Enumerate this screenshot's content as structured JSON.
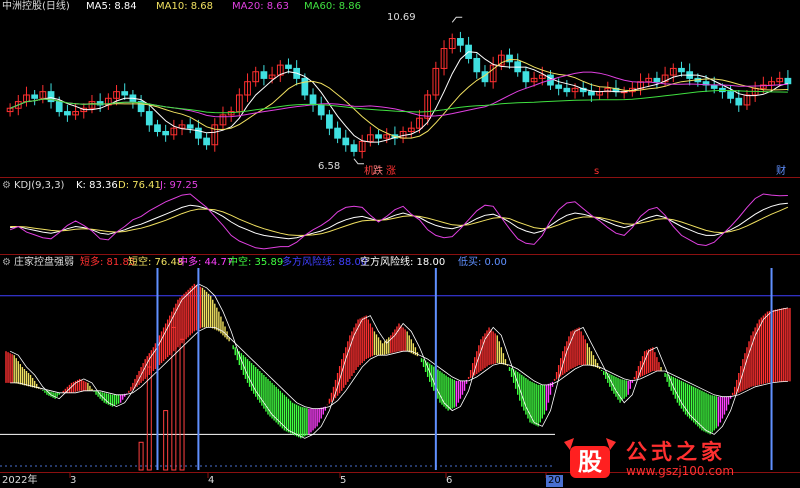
{
  "header_top": {
    "title": "中洲控股(日线)",
    "ma_labels": [
      {
        "text": "MA5: 8.84",
        "color": "#ffffff"
      },
      {
        "text": "MA10: 8.68",
        "color": "#f0e060"
      },
      {
        "text": "MA20: 8.63",
        "color": "#e040e0"
      },
      {
        "text": "MA60: 8.86",
        "color": "#40e040"
      }
    ]
  },
  "price_annotations": {
    "high": "10.69",
    "low": "6.58"
  },
  "event_markers": [
    {
      "text": "机",
      "color": "#ff4040"
    },
    {
      "text": "跌",
      "color": "#ff8080"
    },
    {
      "text": "涨",
      "color": "#ff3030"
    },
    {
      "text": "s",
      "color": "#ff3030"
    },
    {
      "text": "财",
      "color": "#6090ff"
    }
  ],
  "header_kdj": {
    "name": "KDJ(9,3,3)",
    "k": "K: 83.36",
    "d": "D: 76.41",
    "j": "J: 97.25",
    "colors": {
      "k": "#ffffff",
      "d": "#f0e060",
      "j": "#e040e0"
    }
  },
  "header_zj": {
    "name": "庄家控盘强弱",
    "items": [
      {
        "text": "短多: 81.85",
        "color": "#ff3030"
      },
      {
        "text": "短空: 76.48",
        "color": "#f0e060"
      },
      {
        "text": "中多: 44.77",
        "color": "#ff40ff"
      },
      {
        "text": "中空: 35.89",
        "color": "#40ff40"
      },
      {
        "text": "多方风险线: 88.00",
        "color": "#4040ff"
      },
      {
        "text": "空方风险线: 18.00",
        "color": "#ffffff"
      },
      {
        "text": "低买: 0.00",
        "color": "#6090ff"
      }
    ]
  },
  "x_axis": {
    "labels": [
      "2022年",
      "3",
      "4",
      "5",
      "6",
      "20"
    ]
  },
  "watermark": {
    "logo_text": "股",
    "text": "公式之家",
    "url": "www.gszj100.com"
  },
  "chart_data": [
    {
      "type": "candlestick",
      "title": "中洲控股(日线)",
      "close": [
        8.1,
        8.3,
        8.5,
        8.4,
        8.6,
        8.3,
        8.0,
        7.9,
        8.0,
        8.1,
        8.3,
        8.2,
        8.4,
        8.6,
        8.5,
        8.3,
        8.0,
        7.6,
        7.4,
        7.3,
        7.5,
        7.6,
        7.5,
        7.2,
        7.0,
        7.6,
        7.9,
        8.0,
        8.5,
        8.9,
        9.2,
        9.0,
        9.1,
        9.4,
        9.3,
        9.0,
        8.5,
        8.2,
        7.9,
        7.5,
        7.2,
        7.0,
        6.8,
        7.1,
        7.3,
        7.2,
        7.3,
        7.2,
        7.4,
        7.5,
        7.8,
        8.5,
        9.3,
        9.9,
        10.2,
        10.0,
        9.6,
        9.2,
        8.9,
        9.4,
        9.7,
        9.5,
        9.2,
        8.9,
        9.0,
        9.1,
        8.8,
        8.7,
        8.6,
        8.7,
        8.6,
        8.5,
        8.6,
        8.7,
        8.6,
        8.6,
        8.7,
        8.9,
        9.0,
        8.9,
        9.1,
        9.3,
        9.2,
        9.0,
        8.9,
        8.8,
        8.7,
        8.6,
        8.4,
        8.2,
        8.5,
        8.7,
        8.8,
        8.9,
        9.0,
        8.84
      ],
      "open": [
        8.0,
        8.1,
        8.3,
        8.5,
        8.4,
        8.6,
        8.3,
        8.0,
        7.9,
        8.0,
        8.1,
        8.3,
        8.2,
        8.4,
        8.6,
        8.5,
        8.3,
        8.0,
        7.6,
        7.4,
        7.3,
        7.5,
        7.6,
        7.5,
        7.2,
        7.0,
        7.6,
        7.9,
        8.0,
        8.5,
        8.9,
        9.2,
        9.0,
        9.1,
        9.4,
        9.3,
        9.0,
        8.5,
        8.2,
        7.9,
        7.5,
        7.2,
        7.0,
        6.8,
        7.1,
        7.3,
        7.2,
        7.3,
        7.2,
        7.4,
        7.5,
        7.8,
        8.5,
        9.3,
        9.9,
        10.2,
        10.0,
        9.6,
        9.2,
        8.9,
        9.4,
        9.7,
        9.5,
        9.2,
        8.9,
        9.0,
        9.1,
        8.8,
        8.7,
        8.6,
        8.7,
        8.6,
        8.5,
        8.6,
        8.7,
        8.6,
        8.6,
        8.7,
        8.9,
        9.0,
        8.9,
        9.1,
        9.3,
        9.2,
        9.0,
        8.9,
        8.8,
        8.7,
        8.6,
        8.4,
        8.2,
        8.5,
        8.7,
        8.8,
        8.9,
        9.0
      ],
      "annotations": {
        "high": 10.69,
        "low": 6.58
      },
      "series": [
        {
          "name": "MA5",
          "color": "#ffffff",
          "last": 8.84
        },
        {
          "name": "MA10",
          "color": "#f0e060",
          "last": 8.68
        },
        {
          "name": "MA20",
          "color": "#e040e0",
          "last": 8.63
        },
        {
          "name": "MA60",
          "color": "#40e040",
          "last": 8.86
        }
      ]
    },
    {
      "type": "line",
      "title": "KDJ(9,3,3)",
      "ylim": [
        0,
        100
      ],
      "series": [
        {
          "name": "K",
          "color": "#ffffff",
          "values": [
            40,
            42,
            38,
            35,
            32,
            30,
            33,
            38,
            42,
            40,
            36,
            30,
            28,
            32,
            36,
            42,
            46,
            52,
            58,
            64,
            70,
            76,
            80,
            78,
            74,
            68,
            60,
            50,
            42,
            36,
            30,
            26,
            24,
            22,
            20,
            22,
            26,
            30,
            34,
            40,
            48,
            54,
            58,
            60,
            56,
            52,
            56,
            62,
            66,
            62,
            58,
            50,
            44,
            40,
            38,
            42,
            48,
            56,
            62,
            64,
            58,
            50,
            40,
            34,
            30,
            34,
            44,
            54,
            62,
            66,
            64,
            60,
            56,
            50,
            44,
            40,
            44,
            52,
            58,
            62,
            58,
            50,
            42,
            36,
            30,
            26,
            26,
            30,
            36,
            44,
            54,
            64,
            72,
            78,
            82,
            83.36
          ]
        },
        {
          "name": "D",
          "color": "#f0e060",
          "values": [
            42,
            42,
            41,
            39,
            37,
            35,
            34,
            35,
            37,
            38,
            37,
            35,
            33,
            32,
            33,
            36,
            39,
            43,
            48,
            53,
            59,
            65,
            70,
            73,
            73,
            72,
            68,
            62,
            55,
            49,
            43,
            38,
            34,
            30,
            27,
            26,
            26,
            27,
            29,
            33,
            38,
            43,
            48,
            52,
            53,
            53,
            54,
            57,
            60,
            61,
            60,
            57,
            53,
            49,
            45,
            44,
            45,
            49,
            53,
            57,
            58,
            56,
            50,
            45,
            40,
            38,
            40,
            45,
            51,
            56,
            59,
            59,
            58,
            55,
            51,
            47,
            46,
            48,
            51,
            55,
            56,
            54,
            50,
            45,
            40,
            35,
            32,
            31,
            33,
            37,
            43,
            50,
            57,
            64,
            70,
            76.41
          ]
        },
        {
          "name": "J",
          "color": "#e040e0",
          "values": [
            36,
            42,
            32,
            27,
            22,
            20,
            31,
            44,
            52,
            44,
            34,
            20,
            18,
            32,
            42,
            54,
            60,
            70,
            78,
            86,
            92,
            98,
            100,
            88,
            76,
            60,
            44,
            26,
            16,
            10,
            4,
            2,
            4,
            6,
            6,
            14,
            26,
            36,
            44,
            54,
            68,
            76,
            78,
            76,
            62,
            50,
            60,
            72,
            78,
            64,
            54,
            36,
            26,
            22,
            24,
            38,
            54,
            70,
            80,
            78,
            58,
            38,
            20,
            12,
            10,
            26,
            52,
            72,
            84,
            86,
            74,
            62,
            52,
            40,
            30,
            26,
            40,
            60,
            72,
            76,
            62,
            42,
            26,
            18,
            10,
            8,
            14,
            28,
            42,
            58,
            76,
            92,
            100,
            98,
            97,
            97.25
          ]
        }
      ]
    },
    {
      "type": "bar",
      "title": "庄家控盘强弱",
      "series": [
        {
          "name": "短多",
          "color": "#ff3030",
          "last": 81.85
        },
        {
          "name": "短空",
          "color": "#f0e060",
          "last": 76.48
        },
        {
          "name": "中多",
          "color": "#ff40ff",
          "last": 44.77
        },
        {
          "name": "中空",
          "color": "#40ff40",
          "last": 35.89
        },
        {
          "name": "多方风险线",
          "color": "#4040ff",
          "last": 88.0
        },
        {
          "name": "空方风险线",
          "color": "#ffffff",
          "last": 18.0
        },
        {
          "name": "低买",
          "color": "#6090ff",
          "last": 0.0
        }
      ],
      "short_line": [
        60,
        58,
        52,
        48,
        42,
        38,
        36,
        40,
        44,
        46,
        44,
        38,
        34,
        32,
        34,
        40,
        48,
        56,
        62,
        70,
        78,
        86,
        90,
        94,
        92,
        88,
        80,
        70,
        58,
        48,
        40,
        34,
        28,
        24,
        20,
        18,
        16,
        18,
        22,
        30,
        42,
        56,
        68,
        76,
        78,
        70,
        64,
        68,
        74,
        70,
        62,
        52,
        42,
        34,
        30,
        32,
        40,
        54,
        66,
        72,
        68,
        56,
        44,
        32,
        24,
        22,
        30,
        46,
        60,
        70,
        72,
        64,
        56,
        48,
        40,
        34,
        38,
        50,
        60,
        62,
        52,
        42,
        34,
        28,
        24,
        20,
        18,
        22,
        30,
        42,
        56,
        68,
        76,
        80,
        81,
        81.85
      ],
      "mid_line": [
        44,
        44,
        43,
        42,
        41,
        40,
        39,
        39,
        39,
        40,
        40,
        40,
        39,
        38,
        38,
        39,
        42,
        46,
        50,
        54,
        58,
        62,
        66,
        70,
        72,
        72,
        70,
        66,
        62,
        58,
        54,
        50,
        46,
        42,
        38,
        34,
        32,
        31,
        31,
        32,
        35,
        40,
        46,
        52,
        56,
        58,
        58,
        59,
        60,
        60,
        58,
        56,
        53,
        50,
        47,
        45,
        45,
        47,
        50,
        53,
        54,
        53,
        51,
        48,
        45,
        43,
        43,
        45,
        48,
        51,
        53,
        53,
        52,
        50,
        48,
        46,
        45,
        46,
        48,
        50,
        50,
        48,
        46,
        44,
        42,
        40,
        38,
        37,
        37,
        38,
        40,
        42,
        43,
        44,
        44.5,
        44.77
      ],
      "low_buy_markers": [
        18,
        23,
        52,
        93
      ],
      "low_bars": [
        {
          "i": 16,
          "v": 14
        },
        {
          "i": 17,
          "v": 52
        },
        {
          "i": 19,
          "v": 30
        },
        {
          "i": 20,
          "v": 72
        },
        {
          "i": 21,
          "v": 66
        }
      ]
    }
  ]
}
